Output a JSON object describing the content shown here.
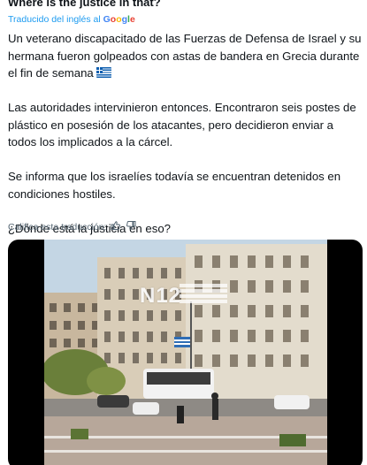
{
  "tweet": {
    "original_title": "Where is the justice in that?",
    "translated_label": "Traducido del inglés al",
    "google_word": [
      "G",
      "o",
      "o",
      "g",
      "l",
      "e"
    ],
    "paragraphs": [
      "Un veterano discapacitado de las Fuerzas de Defensa de Israel y su hermana fueron golpeados con astas de bandera en Grecia durante el fin de semana",
      "Las autoridades intervinieron entonces. Encontraron seis postes de plástico en posesión de los atacantes, pero decidieron enviar a todos los implicados a la cárcel.",
      "Se informa que los israelíes todavía se encuentran detenidos en condiciones hostiles.",
      "¿Dónde está la justicia en eso?"
    ],
    "flag_icon": "greece-flag-emoji",
    "rate_label": "Califica esta traducción:",
    "thumb_up_icon": "thumbs-up-icon",
    "thumb_down_icon": "thumbs-down-icon"
  },
  "media": {
    "watermark": "N12"
  },
  "colors": {
    "link_blue": "#1d9bf0",
    "text": "#0f1419",
    "secondary": "#536471"
  }
}
